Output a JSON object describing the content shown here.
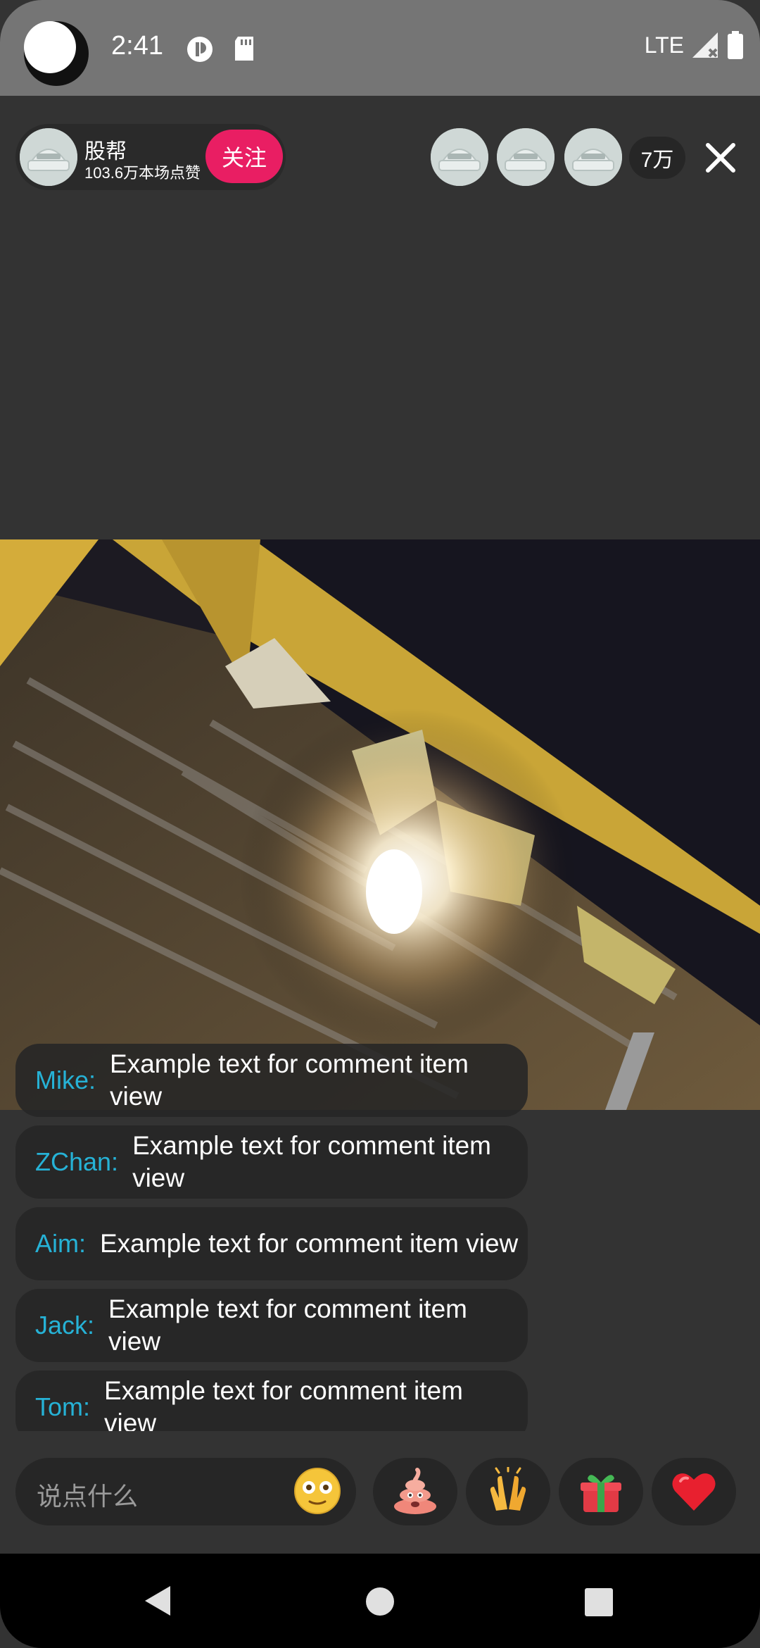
{
  "status_bar": {
    "time": "2:41",
    "network": "LTE"
  },
  "host": {
    "name": "股帮",
    "likes": "103.6万本场点赞",
    "follow_label": "关注"
  },
  "viewers": {
    "count": "7万"
  },
  "comments": [
    {
      "user": "Mike:",
      "text": "Example text for comment item view"
    },
    {
      "user": "ZChan:",
      "text": "Example text for comment item view"
    },
    {
      "user": "Aim:",
      "text": "Example text for comment item view"
    },
    {
      "user": "Jack:",
      "text": "Example text for comment item view"
    },
    {
      "user": "Tom:",
      "text": "Example text for comment item view"
    }
  ],
  "input": {
    "placeholder": "说点什么"
  },
  "actions": [
    {
      "icon": "poop-emoji-icon"
    },
    {
      "icon": "clapping-hands-icon"
    },
    {
      "icon": "gift-icon"
    },
    {
      "icon": "heart-icon"
    }
  ],
  "colors": {
    "accent_follow": "#e91e63",
    "username": "#26b2d6",
    "background": "#333333"
  }
}
